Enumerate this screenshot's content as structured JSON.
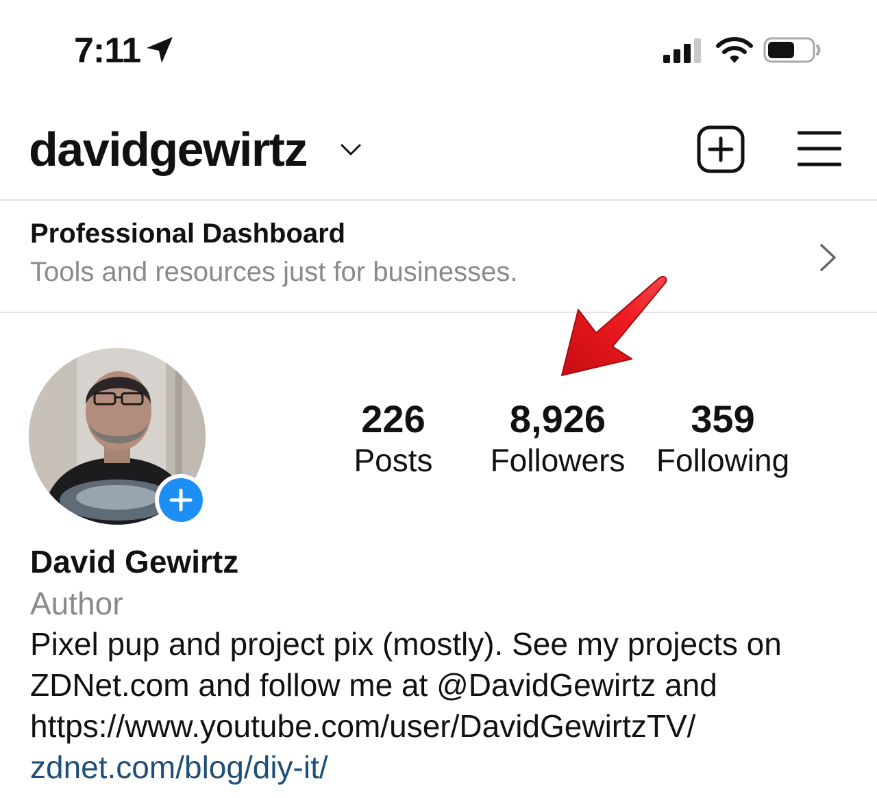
{
  "status_bar": {
    "time": "7:11",
    "location_icon": "location-arrow-icon",
    "signal_icon": "cellular-signal-icon",
    "wifi_icon": "wifi-icon",
    "battery_icon": "battery-icon"
  },
  "header": {
    "username": "davidgewirtz",
    "dropdown_icon": "chevron-down-icon",
    "new_post_icon": "plus-square-icon",
    "menu_icon": "hamburger-menu-icon"
  },
  "dashboard": {
    "title": "Professional Dashboard",
    "subtitle": "Tools and resources just for businesses.",
    "chevron_icon": "chevron-right-icon"
  },
  "profile": {
    "avatar_icon": "profile-photo",
    "add_story_icon": "plus-circle-icon",
    "stats": [
      {
        "value": "226",
        "label": "Posts"
      },
      {
        "value": "8,926",
        "label": "Followers"
      },
      {
        "value": "359",
        "label": "Following"
      }
    ],
    "annotation_icon": "red-arrow-icon"
  },
  "bio": {
    "name": "David Gewirtz",
    "category": "Author",
    "lines": [
      "Pixel pup and project pix (mostly). See my projects on",
      "ZDNet.com and follow me at @DavidGewirtz and",
      "https://www.youtube.com/user/DavidGewirtzTV/"
    ],
    "link": "zdnet.com/blog/diy-it/"
  },
  "colors": {
    "accent_blue": "#1d8ef5",
    "link_blue": "#1f4e79",
    "secondary_text": "#8a8a8a",
    "annotation_red": "#e8141b"
  }
}
